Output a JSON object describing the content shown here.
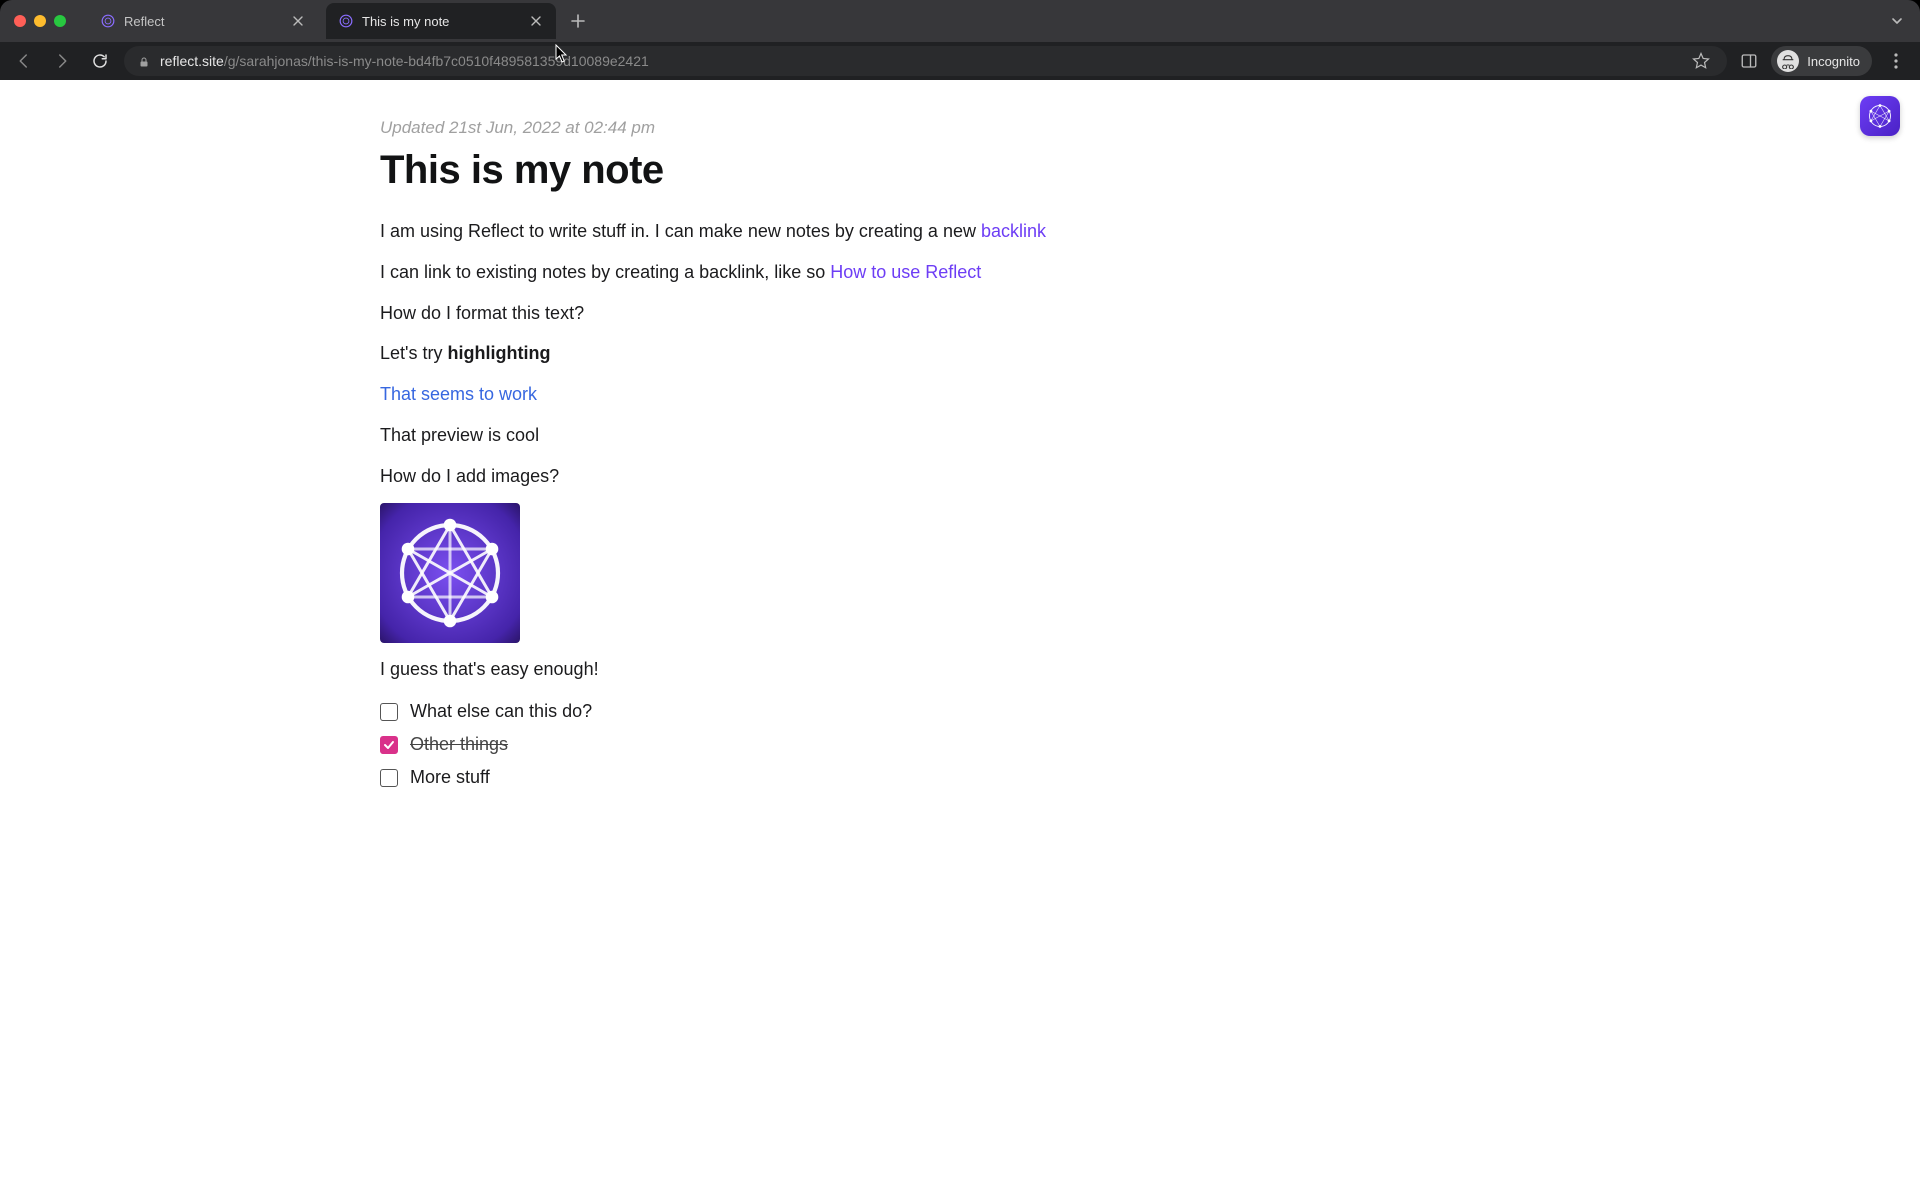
{
  "browser": {
    "tabs": [
      {
        "title": "Reflect",
        "active": false
      },
      {
        "title": "This is my note",
        "active": true
      }
    ],
    "url_host": "reflect.site",
    "url_path": "/g/sarahjonas/this-is-my-note-bd4fb7c0510f489581359d10089e2421",
    "incognito_label": "Incognito"
  },
  "note": {
    "updated": "Updated 21st Jun, 2022 at 02:44 pm",
    "title": "This is my note",
    "p1_intro": "I am using Reflect to write stuff in. I can make new notes by creating a new ",
    "p1_link": "backlink",
    "p2_intro": "I can link to existing notes by creating a backlink, like so ",
    "p2_link": "How to use Reflect",
    "p3": "How do I format this text?",
    "p4_prefix": "Let's try ",
    "p4_bold": "highlighting",
    "p5_link": "That seems to work",
    "p6": "That preview is cool",
    "p7": "How do I add images?",
    "p8": "I guess that's easy enough!",
    "checklist": [
      {
        "label": "What else can this do?",
        "checked": false
      },
      {
        "label": "Other things",
        "checked": true
      },
      {
        "label": "More stuff",
        "checked": false
      }
    ]
  }
}
